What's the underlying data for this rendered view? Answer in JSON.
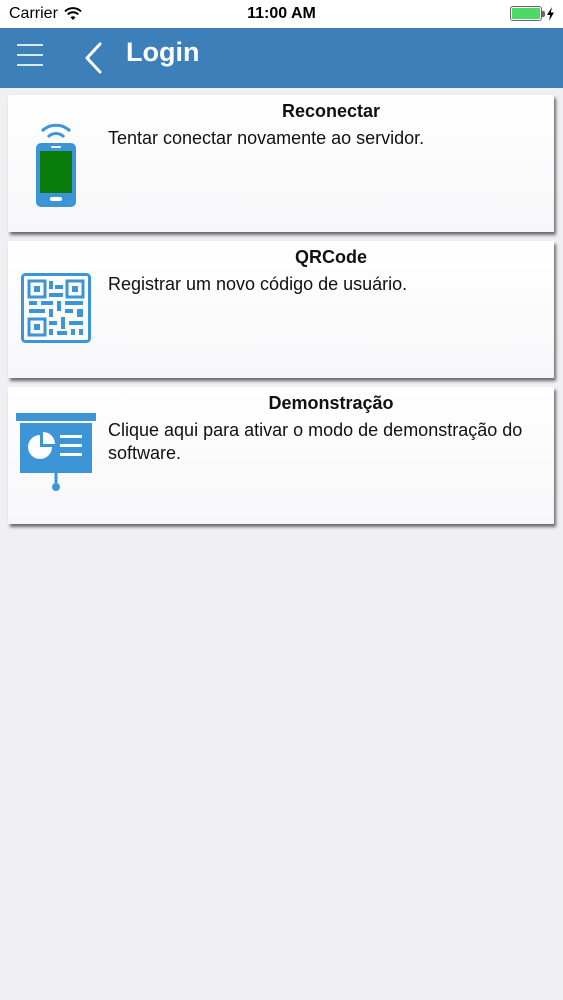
{
  "status_bar": {
    "carrier": "Carrier",
    "time": "11:00 AM",
    "battery_level": 1.0,
    "icons": [
      "wifi-icon",
      "battery-icon",
      "charging-bolt-icon"
    ]
  },
  "nav": {
    "title": "Login",
    "background_color": "#3d7fb8",
    "icons": [
      "menu-icon",
      "back-chevron-icon"
    ]
  },
  "items": [
    {
      "title": "Reconectar",
      "description": "Tentar conectar novamente ao servidor.",
      "icon": "phone-wifi-icon"
    },
    {
      "title": "QRCode",
      "description": "Registrar um novo código de usuário.",
      "icon": "qrcode-icon"
    },
    {
      "title": "Demonstração",
      "description": "Clique aqui para ativar o modo de demonstração do software.",
      "icon": "presentation-icon"
    }
  ],
  "colors": {
    "icon_blue": "#3b95d6",
    "phone_screen": "#0a7d0a",
    "battery_green": "#4cd964"
  }
}
